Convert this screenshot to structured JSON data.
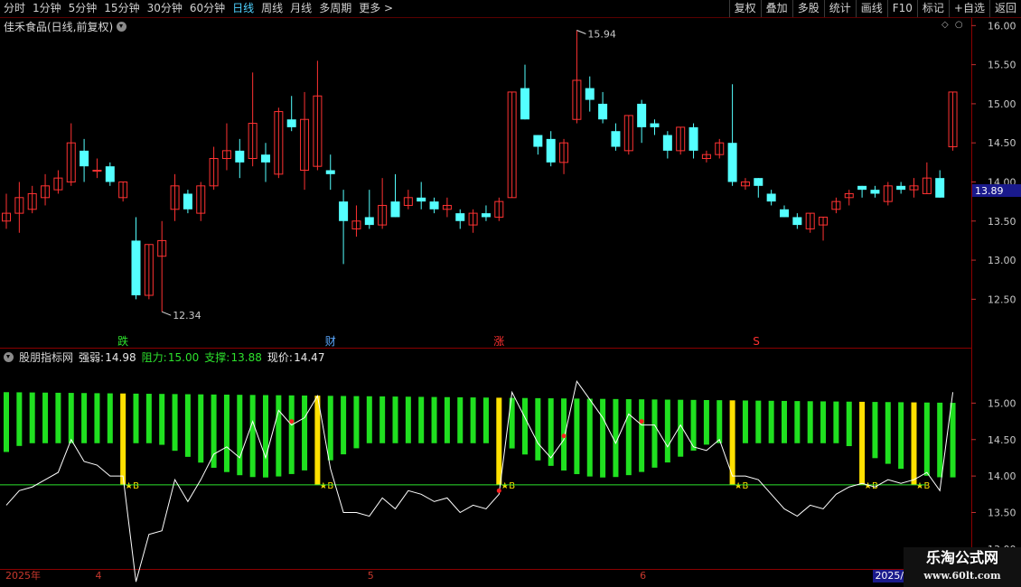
{
  "toolbar": {
    "periods": [
      "分时",
      "1分钟",
      "5分钟",
      "15分钟",
      "30分钟",
      "60分钟",
      "日线",
      "周线",
      "月线",
      "多周期",
      "更多 >"
    ],
    "active_period": "日线",
    "buttons": [
      "复权",
      "叠加",
      "多股",
      "统计",
      "画线",
      "F10",
      "标记",
      "+自选",
      "返回"
    ]
  },
  "main_panel": {
    "title": "佳禾食品(日线,前复权)",
    "y_axis": {
      "min": 12.25,
      "max": 16.05,
      "ticks": [
        "16.00",
        "15.50",
        "15.00",
        "14.50",
        "14.00",
        "13.50",
        "13.00",
        "12.50"
      ]
    },
    "current_price_tag": "13.89",
    "high_marker": "15.94",
    "low_marker": "12.34",
    "event_markers": [
      {
        "label": "跌",
        "color": "#2de22d",
        "bar_index": 9
      },
      {
        "label": "财",
        "color": "#5aa8ff",
        "bar_index": 25
      },
      {
        "label": "涨",
        "color": "#ff3030",
        "bar_index": 38
      },
      {
        "label": "S",
        "color": "#ff3030",
        "bar_index": 58
      }
    ],
    "candles": [
      [
        13.5,
        13.6,
        13.4,
        13.85
      ],
      [
        13.6,
        13.8,
        13.35,
        14.0
      ],
      [
        13.65,
        13.85,
        13.6,
        13.95
      ],
      [
        13.8,
        13.95,
        13.7,
        14.1
      ],
      [
        13.9,
        14.05,
        13.85,
        14.15
      ],
      [
        14.0,
        14.5,
        13.95,
        14.75
      ],
      [
        14.4,
        14.2,
        14.0,
        14.55
      ],
      [
        14.15,
        14.15,
        14.05,
        14.3
      ],
      [
        14.2,
        14.0,
        13.95,
        14.25
      ],
      [
        13.8,
        14.0,
        13.75,
        14.0
      ],
      [
        13.25,
        12.55,
        12.5,
        13.55
      ],
      [
        12.55,
        13.2,
        12.5,
        13.2
      ],
      [
        13.05,
        13.25,
        12.34,
        13.5
      ],
      [
        13.65,
        13.95,
        13.5,
        14.1
      ],
      [
        13.85,
        13.65,
        13.6,
        13.9
      ],
      [
        13.6,
        13.95,
        13.5,
        14.0
      ],
      [
        13.95,
        14.3,
        13.9,
        14.45
      ],
      [
        14.3,
        14.4,
        14.15,
        14.75
      ],
      [
        14.4,
        14.25,
        14.05,
        14.55
      ],
      [
        14.3,
        14.75,
        14.2,
        15.4
      ],
      [
        14.35,
        14.25,
        14.0,
        14.5
      ],
      [
        14.1,
        14.9,
        14.05,
        14.95
      ],
      [
        14.8,
        14.7,
        14.65,
        15.1
      ],
      [
        14.15,
        14.8,
        13.9,
        15.15
      ],
      [
        14.2,
        15.1,
        14.15,
        15.55
      ],
      [
        14.15,
        14.1,
        13.9,
        14.35
      ],
      [
        13.75,
        13.5,
        12.95,
        13.9
      ],
      [
        13.4,
        13.5,
        13.3,
        13.7
      ],
      [
        13.55,
        13.45,
        13.4,
        13.9
      ],
      [
        13.45,
        13.7,
        13.4,
        14.05
      ],
      [
        13.75,
        13.55,
        13.55,
        14.1
      ],
      [
        13.7,
        13.8,
        13.65,
        13.9
      ],
      [
        13.8,
        13.75,
        13.65,
        14.0
      ],
      [
        13.75,
        13.65,
        13.6,
        13.8
      ],
      [
        13.65,
        13.7,
        13.55,
        13.8
      ],
      [
        13.6,
        13.5,
        13.4,
        13.65
      ],
      [
        13.45,
        13.6,
        13.35,
        13.65
      ],
      [
        13.6,
        13.55,
        13.5,
        13.7
      ],
      [
        13.55,
        13.75,
        13.5,
        13.8
      ],
      [
        13.8,
        15.15,
        13.8,
        15.15
      ],
      [
        15.2,
        14.8,
        14.8,
        15.5
      ],
      [
        14.6,
        14.45,
        14.35,
        14.6
      ],
      [
        14.55,
        14.25,
        14.2,
        14.65
      ],
      [
        14.25,
        14.5,
        14.1,
        14.55
      ],
      [
        14.8,
        15.3,
        14.75,
        15.94
      ],
      [
        15.2,
        15.05,
        14.9,
        15.35
      ],
      [
        15.0,
        14.8,
        14.75,
        15.15
      ],
      [
        14.65,
        14.45,
        14.4,
        14.75
      ],
      [
        14.4,
        14.85,
        14.35,
        14.85
      ],
      [
        15.0,
        14.7,
        14.5,
        15.05
      ],
      [
        14.75,
        14.7,
        14.6,
        14.8
      ],
      [
        14.6,
        14.4,
        14.3,
        14.65
      ],
      [
        14.4,
        14.7,
        14.35,
        14.7
      ],
      [
        14.7,
        14.4,
        14.3,
        14.75
      ],
      [
        14.3,
        14.35,
        14.25,
        14.4
      ],
      [
        14.35,
        14.5,
        14.3,
        14.55
      ],
      [
        14.5,
        14.0,
        13.95,
        15.25
      ],
      [
        13.95,
        14.0,
        13.9,
        14.05
      ],
      [
        14.05,
        13.95,
        13.8,
        14.05
      ],
      [
        13.85,
        13.75,
        13.7,
        13.9
      ],
      [
        13.65,
        13.55,
        13.55,
        13.7
      ],
      [
        13.55,
        13.45,
        13.4,
        13.6
      ],
      [
        13.4,
        13.6,
        13.35,
        13.6
      ],
      [
        13.45,
        13.55,
        13.25,
        13.55
      ],
      [
        13.65,
        13.75,
        13.6,
        13.8
      ],
      [
        13.8,
        13.85,
        13.7,
        13.9
      ],
      [
        13.95,
        13.9,
        13.8,
        13.95
      ],
      [
        13.9,
        13.85,
        13.8,
        13.95
      ],
      [
        13.75,
        13.95,
        13.7,
        14.0
      ],
      [
        13.95,
        13.9,
        13.85,
        14.0
      ],
      [
        13.9,
        13.95,
        13.8,
        14.05
      ],
      [
        13.85,
        14.05,
        13.85,
        14.25
      ],
      [
        14.05,
        13.8,
        13.8,
        14.15
      ],
      [
        14.45,
        15.15,
        14.4,
        15.15
      ]
    ]
  },
  "indicator_panel": {
    "name": "股朋指标网",
    "strength_label": "强弱:",
    "strength": "14.98",
    "resistance_label": "阻力:",
    "resistance": "15.00",
    "support_label": "支撑:",
    "support": "13.88",
    "current_label": "现价:",
    "current": "14.47",
    "y_axis": {
      "min": 12.85,
      "max": 15.5,
      "ticks": [
        "15.00",
        "14.50",
        "14.00",
        "13.50",
        "13.00"
      ]
    },
    "buy_label": "B"
  },
  "date_axis": {
    "labels": [
      {
        "text": "2025年",
        "bar_index": 0
      },
      {
        "text": "4",
        "bar_index": 7
      },
      {
        "text": "5",
        "bar_index": 28
      },
      {
        "text": "6",
        "bar_index": 49
      },
      {
        "text": "2025/",
        "bar_index": 67
      }
    ]
  },
  "watermark": {
    "line1": "乐淘公式网",
    "line2": "www.60lt.com"
  },
  "colors": {
    "up": "#ff3232",
    "down": "#54ffff",
    "bar_green": "#20e020",
    "bar_yellow": "#ffe000",
    "support_line": "#2de22d",
    "grid_red": "#8b0000",
    "price_tag_bg": "#1a1a8c"
  }
}
